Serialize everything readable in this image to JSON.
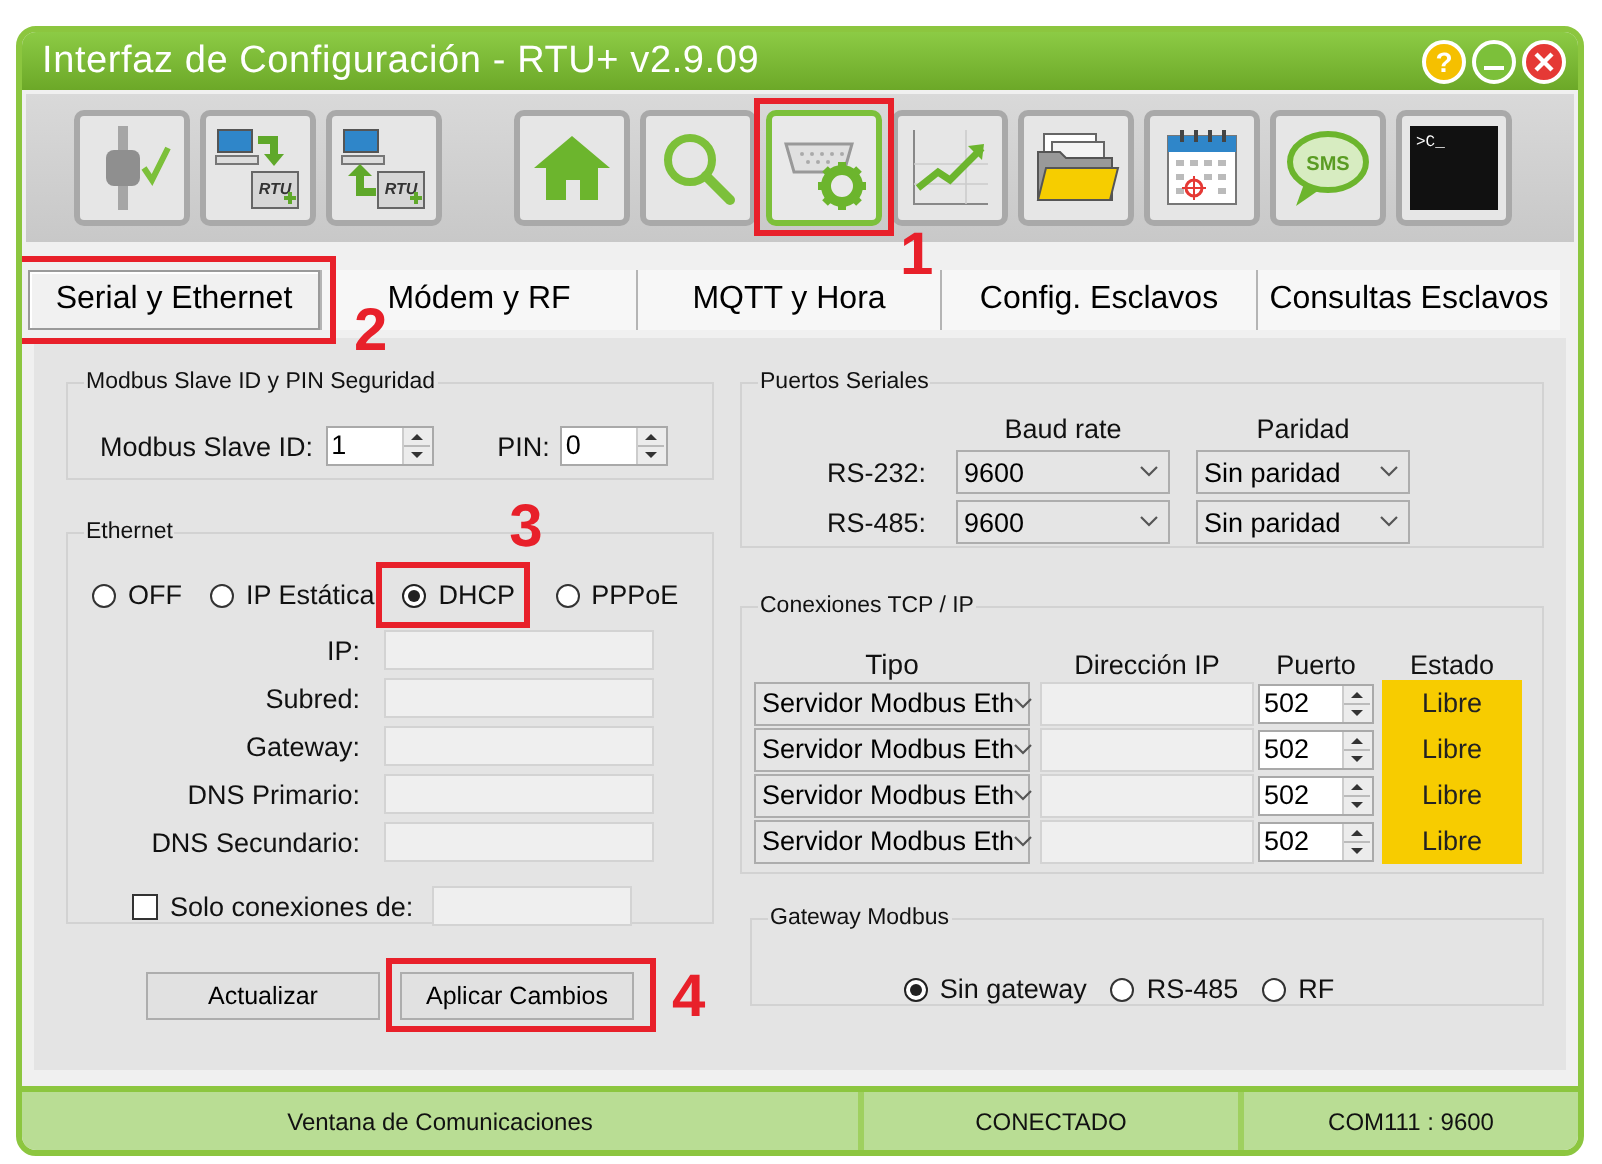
{
  "window": {
    "title": "Interfaz de Configuración - RTU+ v2.9.09",
    "help_button": "?"
  },
  "toolbar": [
    {
      "buttons": [
        {
          "selected": false
        },
        {
          "selected": false,
          "label": "RTU"
        },
        {
          "selected": false,
          "label": "RTU"
        }
      ]
    },
    {
      "buttons": [
        {
          "selected": false
        },
        {
          "selected": false
        },
        {
          "selected": true,
          "callout": "1"
        },
        {
          "selected": false
        },
        {
          "selected": false
        },
        {
          "selected": false
        },
        {
          "selected": false,
          "label": "SMS"
        },
        {
          "selected": false,
          "label": ">C_"
        }
      ]
    }
  ],
  "tabs": [
    {
      "label": "Serial y Ethernet",
      "selected": true,
      "callout": "2"
    },
    {
      "label": "Módem y RF",
      "selected": false
    },
    {
      "label": "MQTT y Hora",
      "selected": false
    },
    {
      "label": "Config. Esclavos",
      "selected": false
    },
    {
      "label": "Consultas Esclavos",
      "selected": false
    }
  ],
  "slave_group": {
    "title": "Modbus Slave ID y PIN Seguridad",
    "slave_id_label": "Modbus Slave ID:",
    "slave_id": "1",
    "pin_label": "PIN:",
    "pin": "0"
  },
  "ethernet": {
    "title": "Ethernet",
    "modes": [
      {
        "label": "OFF",
        "selected": false
      },
      {
        "label": "IP Estática",
        "selected": false
      },
      {
        "label": "DHCP",
        "selected": true,
        "callout": "3"
      },
      {
        "label": "PPPoE",
        "selected": false
      }
    ],
    "fields": [
      {
        "label": "IP:"
      },
      {
        "label": "Subred:"
      },
      {
        "label": "Gateway:"
      },
      {
        "label": "DNS Primario:"
      },
      {
        "label": "DNS Secundario:"
      }
    ],
    "only_from": {
      "label": "Solo conexiones de:",
      "checked": false
    }
  },
  "buttons": [
    {
      "label": "Actualizar"
    },
    {
      "label": "Aplicar Cambios",
      "callout": "4"
    }
  ],
  "serial_ports": {
    "title": "Puertos Seriales",
    "columns": [
      "Baud rate",
      "Paridad"
    ],
    "rows": [
      {
        "label": "RS-232:",
        "baud": "9600",
        "parity": "Sin paridad"
      },
      {
        "label": "RS-485:",
        "baud": "9600",
        "parity": "Sin paridad"
      }
    ]
  },
  "tcp": {
    "title": "Conexiones TCP / IP",
    "columns": [
      "Tipo",
      "Dirección IP",
      "Puerto",
      "Estado"
    ],
    "rows": [
      {
        "type": "Servidor Modbus Eth",
        "port": "502",
        "status": "Libre"
      },
      {
        "type": "Servidor Modbus Eth",
        "port": "502",
        "status": "Libre"
      },
      {
        "type": "Servidor Modbus Eth",
        "port": "502",
        "status": "Libre"
      },
      {
        "type": "Servidor Modbus Eth",
        "port": "502",
        "status": "Libre"
      }
    ]
  },
  "gateway": {
    "title": "Gateway Modbus",
    "options": [
      {
        "label": "Sin gateway",
        "selected": true
      },
      {
        "label": "RS-485",
        "selected": false
      },
      {
        "label": "RF",
        "selected": false
      }
    ]
  },
  "status_bar": [
    "Ventana de Comunicaciones",
    "CONECTADO",
    "COM111 : 9600"
  ]
}
